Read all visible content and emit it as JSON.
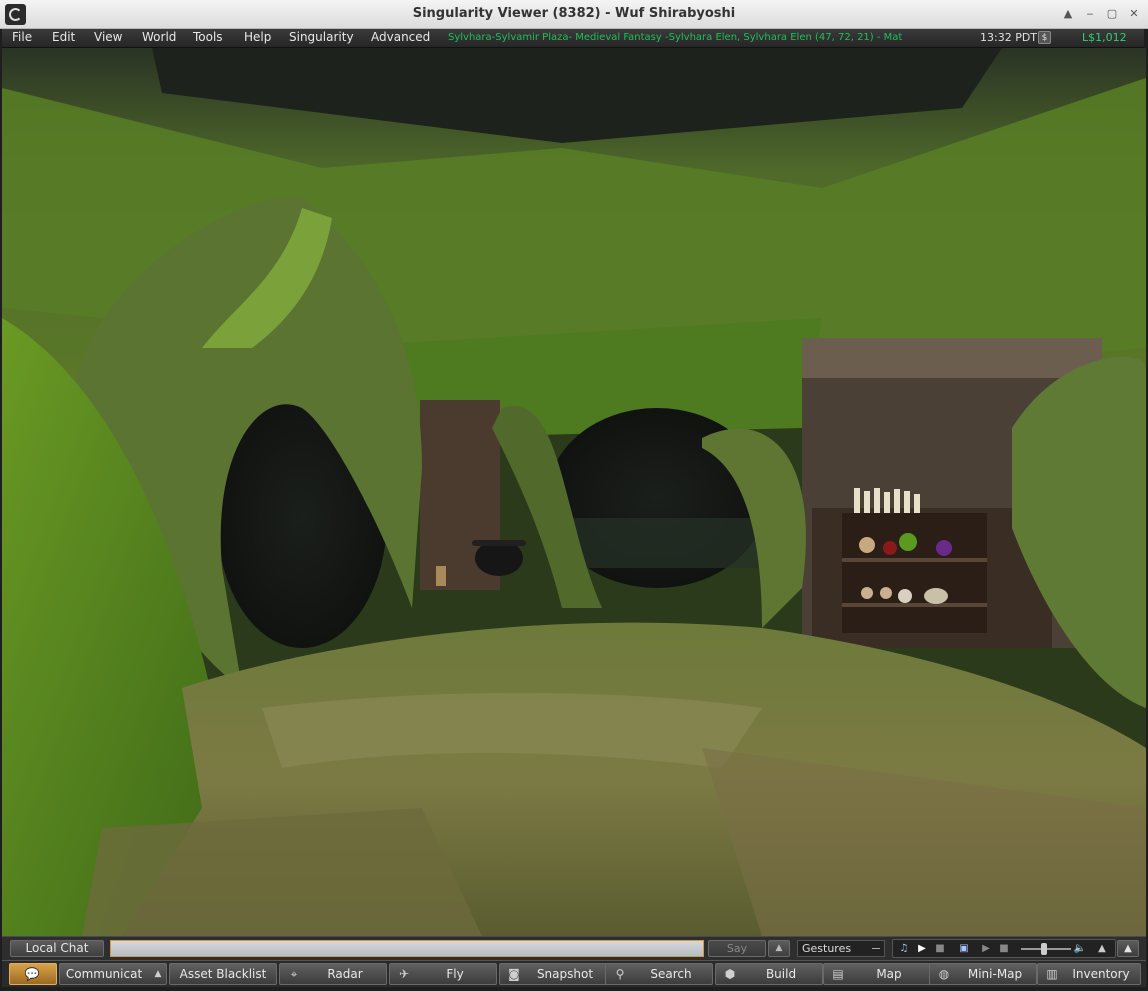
{
  "window": {
    "title": "Singularity Viewer (8382) - Wuf Shirabyoshi",
    "controls": [
      "▲",
      "‒",
      "▢",
      "✕"
    ]
  },
  "menubar": {
    "items": [
      "File",
      "Edit",
      "View",
      "World",
      "Tools",
      "Help",
      "Singularity",
      "Advanced"
    ],
    "location": "Sylvhara-Sylvamir Plaza- Medieval Fantasy -Sylvhara Elen, Sylvhara Elen (47, 72, 21) - Mat",
    "time": "13:32 PDT",
    "currency_icon": "$",
    "balance": "L$1,012"
  },
  "chatbar": {
    "local_chat_label": "Local Chat",
    "input_value": "",
    "say_label": "Say",
    "say_arrow": "▲",
    "gestures_label": "Gestures",
    "collapse": "▲"
  },
  "media": {
    "music_icon": "♫",
    "play_icon": "▶",
    "stop_icon": "■",
    "media_icon": "▣",
    "play2_icon": "▶",
    "stop2_icon": "■",
    "volume_icon": "🔈",
    "up_icon": "▲",
    "volume_level": 0.45
  },
  "toolbar": {
    "chat_icon": "💬",
    "communicate_label": "Communicat",
    "communicate_arrow": "▲",
    "asset_blacklist_label": "Asset Blacklist",
    "radar_label": "Radar",
    "fly_label": "Fly",
    "snapshot_label": "Snapshot",
    "search_label": "Search",
    "build_label": "Build",
    "map_label": "Map",
    "minimap_label": "Mini-Map",
    "inventory_label": "Inventory"
  },
  "colors": {
    "location_text": "#1fbf5a",
    "balance_text": "#2fd070",
    "chat_active": "#d9a24a"
  }
}
